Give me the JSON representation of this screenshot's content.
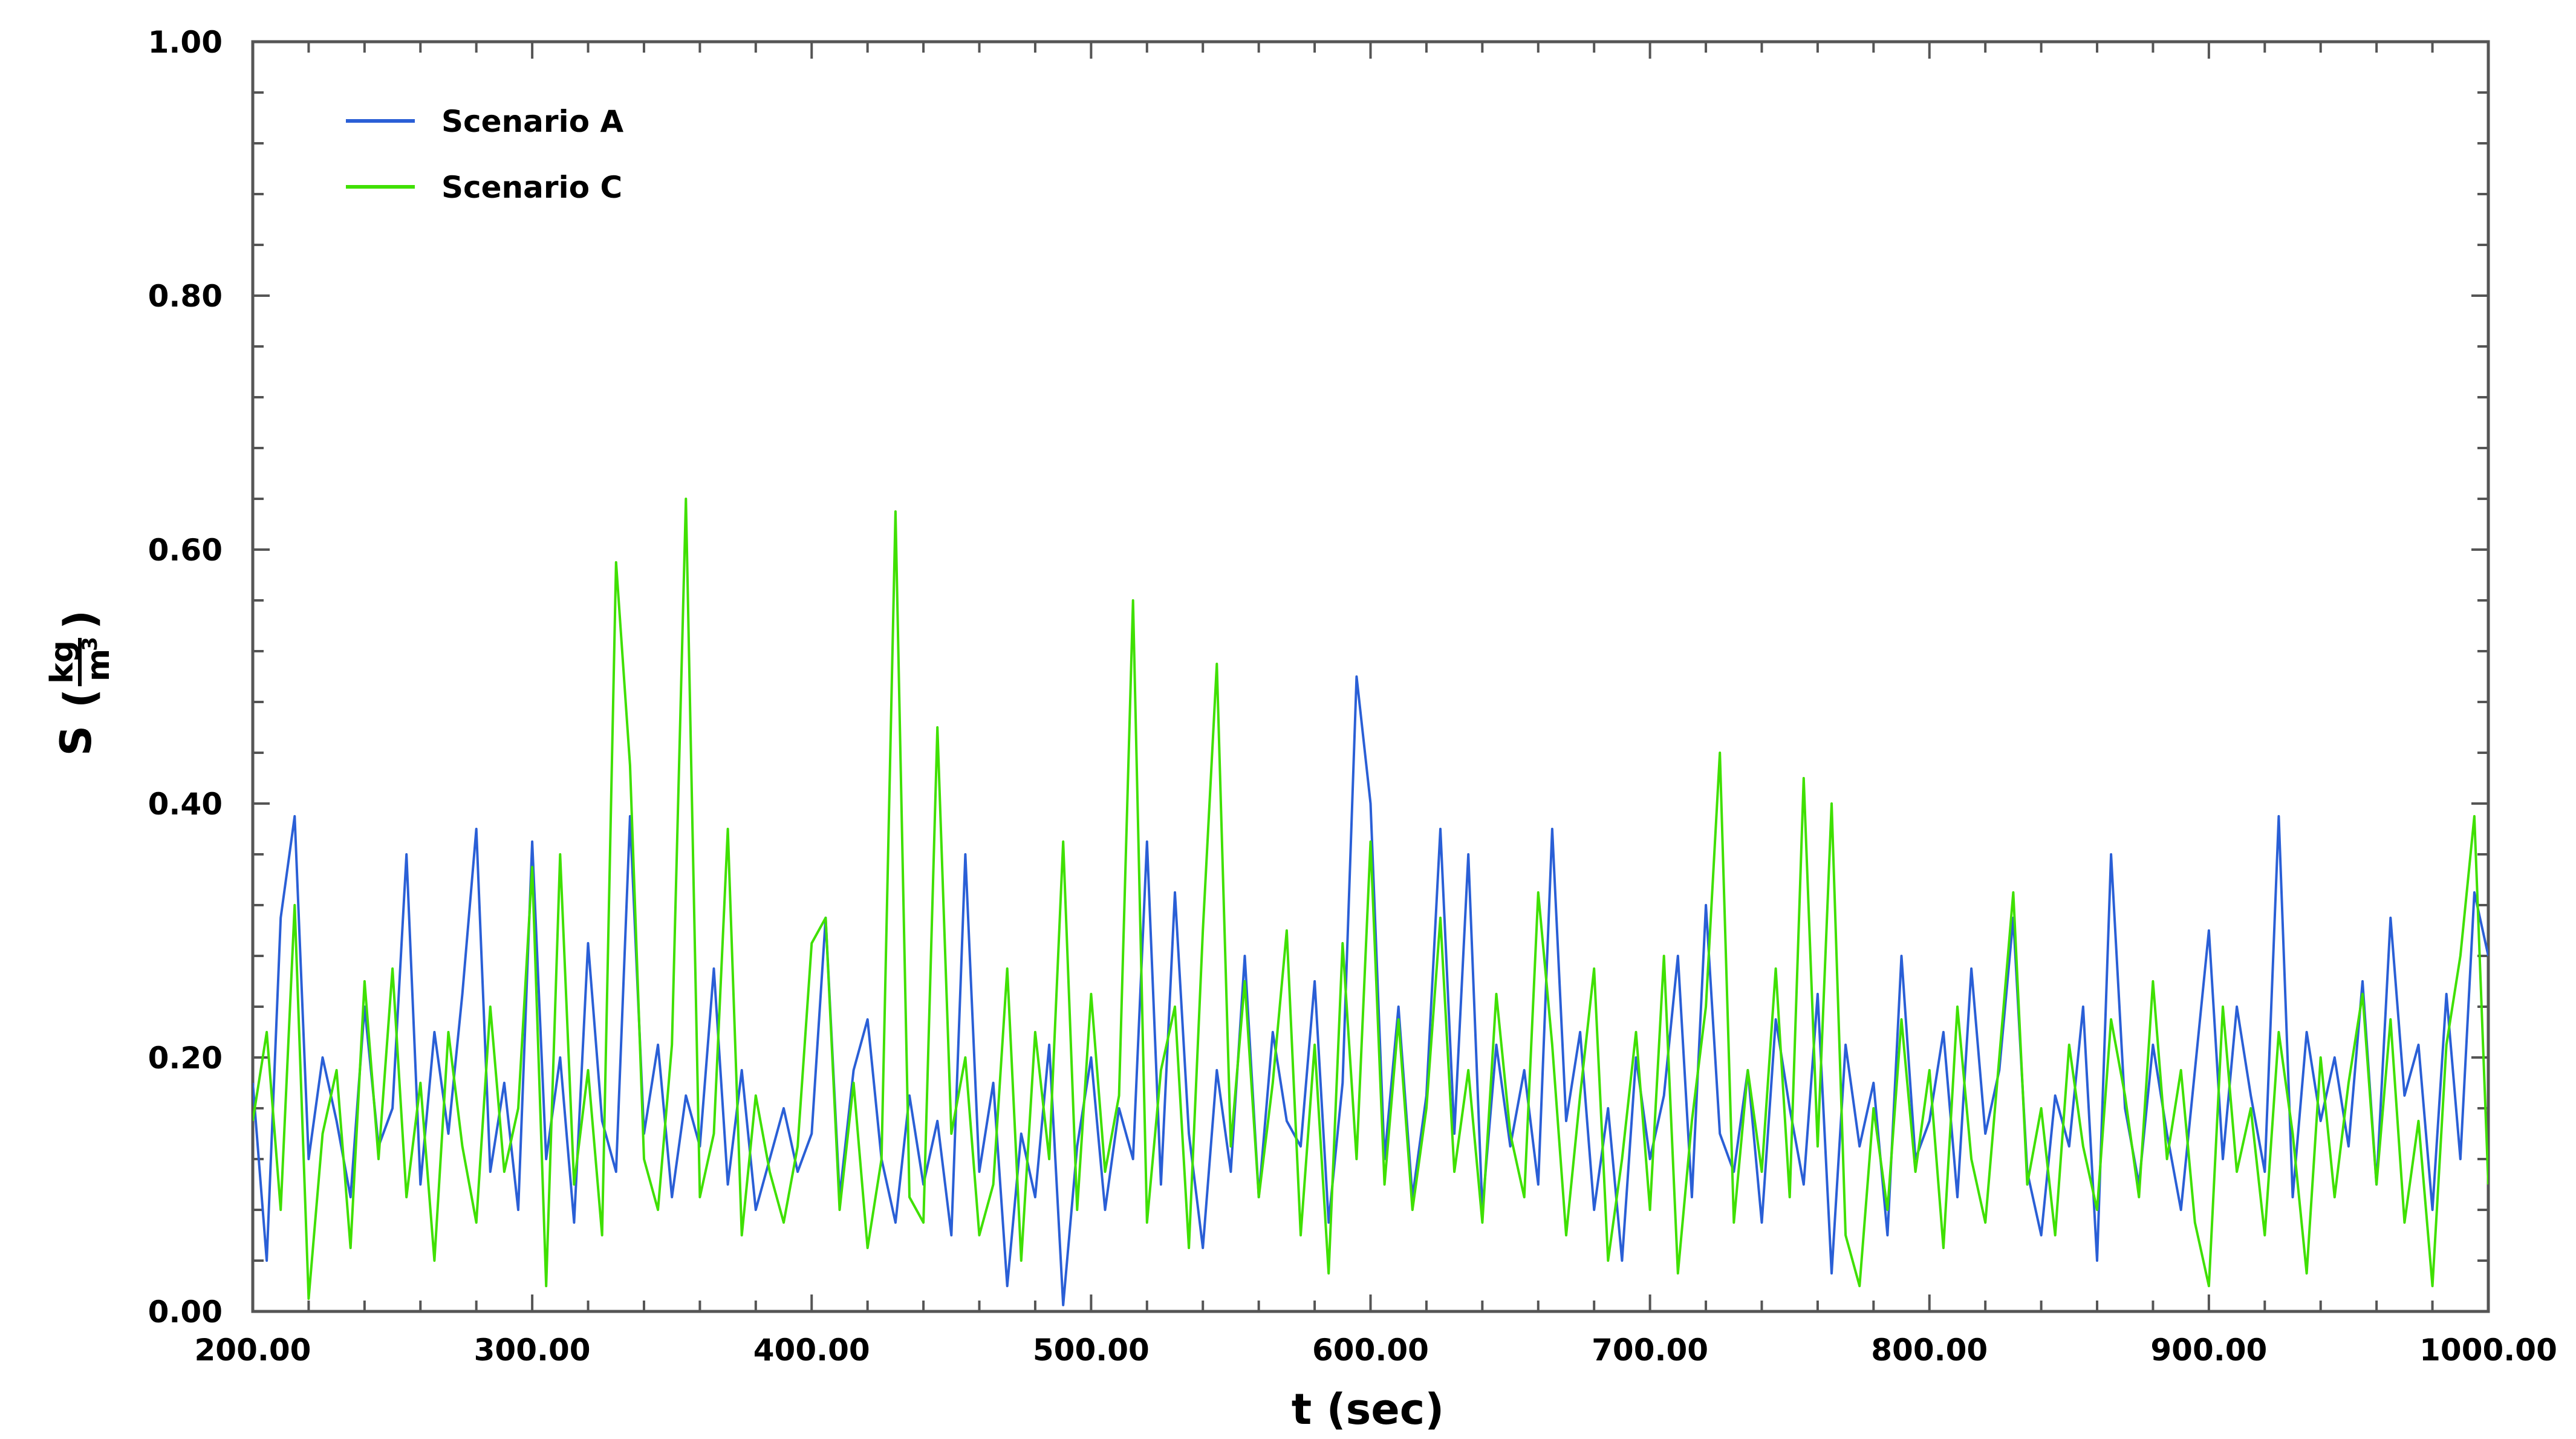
{
  "chart_data": {
    "type": "line",
    "title": "",
    "xlabel": "t (sec)",
    "ylabel": {
      "symbol": "S",
      "open": "(",
      "unit_num": "kg",
      "unit_den": "m",
      "unit_den_exp": "3",
      "close": ")"
    },
    "xlim": [
      200,
      1000
    ],
    "ylim": [
      0,
      1
    ],
    "xticks": [
      "200.00",
      "300.00",
      "400.00",
      "500.00",
      "600.00",
      "700.00",
      "800.00",
      "900.00",
      "1000.00"
    ],
    "yticks": [
      "0.00",
      "0.20",
      "0.40",
      "0.60",
      "0.80",
      "1.00"
    ],
    "x_start": 200,
    "x_step": 5,
    "grid": false,
    "legend_position": "top-left",
    "series": [
      {
        "name": "Scenario A",
        "color": "#2a5fd6",
        "values": [
          0.18,
          0.04,
          0.31,
          0.39,
          0.12,
          0.2,
          0.15,
          0.09,
          0.24,
          0.13,
          0.16,
          0.36,
          0.1,
          0.22,
          0.14,
          0.25,
          0.38,
          0.11,
          0.18,
          0.08,
          0.37,
          0.12,
          0.2,
          0.07,
          0.29,
          0.15,
          0.11,
          0.39,
          0.14,
          0.21,
          0.09,
          0.17,
          0.13,
          0.27,
          0.1,
          0.19,
          0.08,
          0.12,
          0.16,
          0.11,
          0.14,
          0.31,
          0.09,
          0.19,
          0.23,
          0.12,
          0.07,
          0.17,
          0.1,
          0.15,
          0.06,
          0.36,
          0.11,
          0.18,
          0.02,
          0.14,
          0.09,
          0.21,
          0.005,
          0.13,
          0.2,
          0.08,
          0.16,
          0.12,
          0.37,
          0.1,
          0.33,
          0.14,
          0.05,
          0.19,
          0.11,
          0.28,
          0.09,
          0.22,
          0.15,
          0.13,
          0.26,
          0.07,
          0.18,
          0.5,
          0.4,
          0.12,
          0.24,
          0.09,
          0.17,
          0.38,
          0.14,
          0.36,
          0.08,
          0.21,
          0.13,
          0.19,
          0.1,
          0.38,
          0.15,
          0.22,
          0.08,
          0.16,
          0.04,
          0.2,
          0.12,
          0.17,
          0.28,
          0.09,
          0.32,
          0.14,
          0.11,
          0.19,
          0.07,
          0.23,
          0.16,
          0.1,
          0.25,
          0.03,
          0.21,
          0.13,
          0.18,
          0.06,
          0.28,
          0.12,
          0.15,
          0.22,
          0.09,
          0.27,
          0.14,
          0.19,
          0.31,
          0.11,
          0.06,
          0.17,
          0.13,
          0.24,
          0.04,
          0.36,
          0.16,
          0.1,
          0.21,
          0.14,
          0.08,
          0.19,
          0.3,
          0.12,
          0.24,
          0.17,
          0.11,
          0.39,
          0.09,
          0.22,
          0.15,
          0.2,
          0.13,
          0.26,
          0.1,
          0.31,
          0.17,
          0.21,
          0.08,
          0.25,
          0.12,
          0.33,
          0.28
        ]
      },
      {
        "name": "Scenario C",
        "color": "#3fe000",
        "values": [
          0.15,
          0.22,
          0.08,
          0.32,
          0.01,
          0.14,
          0.19,
          0.05,
          0.26,
          0.12,
          0.27,
          0.09,
          0.18,
          0.04,
          0.22,
          0.13,
          0.07,
          0.24,
          0.11,
          0.16,
          0.35,
          0.02,
          0.36,
          0.1,
          0.19,
          0.06,
          0.59,
          0.43,
          0.12,
          0.08,
          0.21,
          0.64,
          0.09,
          0.14,
          0.38,
          0.06,
          0.17,
          0.11,
          0.07,
          0.13,
          0.29,
          0.31,
          0.08,
          0.18,
          0.05,
          0.12,
          0.63,
          0.09,
          0.07,
          0.46,
          0.14,
          0.2,
          0.06,
          0.1,
          0.27,
          0.04,
          0.22,
          0.12,
          0.37,
          0.08,
          0.25,
          0.11,
          0.17,
          0.56,
          0.07,
          0.19,
          0.24,
          0.05,
          0.3,
          0.51,
          0.13,
          0.26,
          0.09,
          0.18,
          0.3,
          0.06,
          0.21,
          0.03,
          0.29,
          0.12,
          0.37,
          0.1,
          0.23,
          0.08,
          0.16,
          0.31,
          0.11,
          0.19,
          0.07,
          0.25,
          0.14,
          0.09,
          0.33,
          0.21,
          0.06,
          0.17,
          0.27,
          0.04,
          0.12,
          0.22,
          0.08,
          0.28,
          0.03,
          0.15,
          0.24,
          0.44,
          0.07,
          0.19,
          0.11,
          0.27,
          0.09,
          0.42,
          0.13,
          0.4,
          0.06,
          0.02,
          0.16,
          0.08,
          0.23,
          0.11,
          0.19,
          0.05,
          0.24,
          0.12,
          0.07,
          0.2,
          0.33,
          0.1,
          0.16,
          0.06,
          0.21,
          0.13,
          0.08,
          0.23,
          0.17,
          0.09,
          0.26,
          0.12,
          0.19,
          0.07,
          0.02,
          0.24,
          0.11,
          0.16,
          0.06,
          0.22,
          0.14,
          0.03,
          0.2,
          0.09,
          0.18,
          0.25,
          0.1,
          0.23,
          0.07,
          0.15,
          0.02,
          0.21,
          0.28,
          0.39,
          0.1
        ]
      }
    ]
  }
}
